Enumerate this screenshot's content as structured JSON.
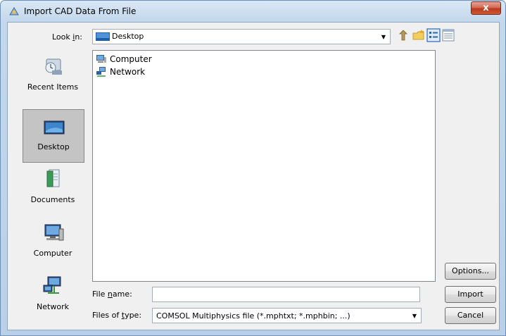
{
  "window": {
    "title": "Import CAD Data From File",
    "close_glyph": "x"
  },
  "lookin": {
    "label_prefix": "Look ",
    "label_accel": "i",
    "label_suffix": "n:",
    "value": "Desktop",
    "icon": "desktop-icon"
  },
  "toolbar": {
    "buttons": [
      "up-folder-icon",
      "new-folder-icon",
      "list-view-icon",
      "details-view-icon"
    ]
  },
  "places": [
    {
      "label": "Recent Items",
      "icon": "recent-items-icon",
      "selected": false
    },
    {
      "label": "Desktop",
      "icon": "desktop-icon",
      "selected": true
    },
    {
      "label": "Documents",
      "icon": "documents-icon",
      "selected": false
    },
    {
      "label": "Computer",
      "icon": "computer-icon",
      "selected": false
    },
    {
      "label": "Network",
      "icon": "network-icon",
      "selected": false
    }
  ],
  "files": [
    {
      "label": "Computer",
      "icon": "computer-icon"
    },
    {
      "label": "Network",
      "icon": "network-icon"
    }
  ],
  "filename": {
    "label_prefix": "File ",
    "label_accel": "n",
    "label_suffix": "ame:",
    "value": ""
  },
  "filetype": {
    "label_prefix": "Files of ",
    "label_accel": "t",
    "label_suffix": "ype:",
    "value": "COMSOL Multiphysics file (*.mphtxt; *.mphbin; ...)"
  },
  "buttons": {
    "options": "Options...",
    "import": "Import",
    "cancel": "Cancel"
  },
  "colors": {
    "title_gradient_top": "#d9e7f4",
    "close_red": "#c8432a",
    "selection_gray": "#c4c4c4"
  }
}
